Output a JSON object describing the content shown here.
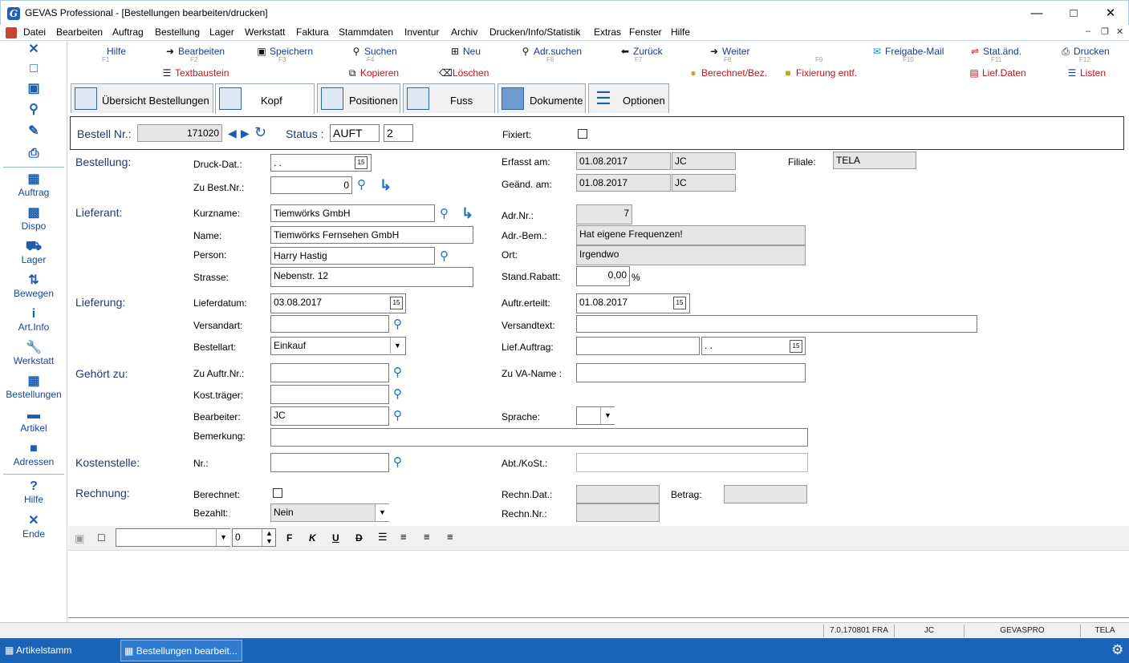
{
  "window": {
    "title": "GEVAS Professional - [Bestellungen bearbeiten/drucken]"
  },
  "menu": [
    "Datei",
    "Bearbeiten",
    "Auftrag",
    "Bestellung",
    "Lager",
    "Werkstatt",
    "Faktura",
    "Stammdaten",
    "Inventur",
    "Archiv",
    "Drucken/Info/Statistik",
    "Extras",
    "Fenster",
    "Hilfe"
  ],
  "sidebar": [
    "Auftrag",
    "Dispo",
    "Lager",
    "Bewegen",
    "Art.Info",
    "Werkstatt",
    "Bestellungen",
    "Artikel",
    "Adressen",
    "Hilfe",
    "Ende"
  ],
  "toolbar": {
    "row1": [
      {
        "label": "Hilfe",
        "key": "F1"
      },
      {
        "label": "Bearbeiten",
        "key": "F2"
      },
      {
        "label": "Speichern",
        "key": "F3"
      },
      {
        "label": "Suchen",
        "key": "F4"
      },
      {
        "label": "Neu",
        "key": "F5"
      },
      {
        "label": "Adr.suchen",
        "key": "F6"
      },
      {
        "label": "Zurück",
        "key": "F7"
      },
      {
        "label": "Weiter",
        "key": "F8"
      },
      {
        "label": "",
        "key": "F9"
      },
      {
        "label": "Freigabe-Mail",
        "key": "F10"
      },
      {
        "label": "Stat.änd.",
        "key": "F11"
      },
      {
        "label": "Drucken",
        "key": "F12"
      }
    ],
    "row2": [
      "Textbaustein",
      "Kopieren",
      "Löschen",
      "Berechnet/Bez.",
      "Fixierung entf.",
      "Lief.Daten",
      "Listen"
    ]
  },
  "tabs": [
    "Übersicht Bestellungen",
    "Kopf",
    "Positionen",
    "Fuss",
    "Dokumente",
    "Optionen"
  ],
  "header": {
    "bestell_nr_label": "Bestell Nr.:",
    "bestell_nr": "171020",
    "status_label": "Status :",
    "status": "AUFT",
    "status_num": "2",
    "fixiert_label": "Fixiert:"
  },
  "sections": {
    "bestellung": "Bestellung:",
    "lieferant": "Lieferant:",
    "lieferung": "Lieferung:",
    "gehoert": "Gehört zu:",
    "kostenstelle": "Kostenstelle:",
    "rechnung": "Rechnung:"
  },
  "bestellung": {
    "druck_dat_label": "Druck-Dat.:",
    "druck_dat": "  .  .",
    "zu_best_label": "Zu Best.Nr.:",
    "zu_best": "0",
    "erfasst_label": "Erfasst am:",
    "erfasst": "01.08.2017",
    "erfasst_by": "JC",
    "geaend_label": "Geänd. am:",
    "geaend": "01.08.2017",
    "geaend_by": "JC",
    "filiale_label": "Filiale:",
    "filiale": "TELA"
  },
  "lieferant": {
    "kurzname_label": "Kurzname:",
    "kurzname": "Tiemwörks GmbH",
    "name_label": "Name:",
    "name": "Tiemwörks Fernsehen GmbH",
    "person_label": "Person:",
    "person": "Harry Hastig",
    "strasse_label": "Strasse:",
    "strasse": "Nebenstr. 12",
    "adrnr_label": "Adr.Nr.:",
    "adrnr": "7",
    "adrbem_label": "Adr.-Bem.:",
    "adrbem": "Hat eigene Frequenzen!",
    "ort_label": "Ort:",
    "ort": "Irgendwo",
    "rabatt_label": "Stand.Rabatt:",
    "rabatt": "0,00",
    "rabatt_unit": "%"
  },
  "lieferung": {
    "lieferdatum_label": "Lieferdatum:",
    "lieferdatum": "03.08.2017",
    "versandart_label": "Versandart:",
    "versandart": "",
    "bestellart_label": "Bestellart:",
    "bestellart": "Einkauf",
    "auftr_label": "Auftr.erteilt:",
    "auftr": "01.08.2017",
    "versandtext_label": "Versandtext:",
    "versandtext": "",
    "liefauftrag_label": "Lief.Auftrag:",
    "liefauftrag": "",
    "liefauftrag_dat": "  .  ."
  },
  "gehoert": {
    "auftr_label": "Zu Auftr.Nr.:",
    "kost_label": "Kost.träger:",
    "bearb_label": "Bearbeiter:",
    "bearb": "JC",
    "bemerkung_label": "Bemerkung:",
    "va_label": "Zu VA-Name :",
    "sprache_label": "Sprache:"
  },
  "kostenstelle": {
    "nr_label": "Nr.:",
    "abt_label": "Abt./KoSt.:"
  },
  "rechnung": {
    "berechnet_label": "Berechnet:",
    "bezahlt_label": "Bezahlt:",
    "bezahlt": "Nein",
    "rdat_label": "Rechn.Dat.:",
    "betrag_label": "Betrag:",
    "rnr_label": "Rechn.Nr.:"
  },
  "editor": {
    "size": "0",
    "bold": "F",
    "italic": "K",
    "underline": "U",
    "strike": "D"
  },
  "status": [
    "7.0.170801 FRA",
    "JC",
    "GEVASPRO",
    "TELA"
  ],
  "taskbar": [
    "Artikelstamm",
    "Bestellungen bearbeit..."
  ]
}
